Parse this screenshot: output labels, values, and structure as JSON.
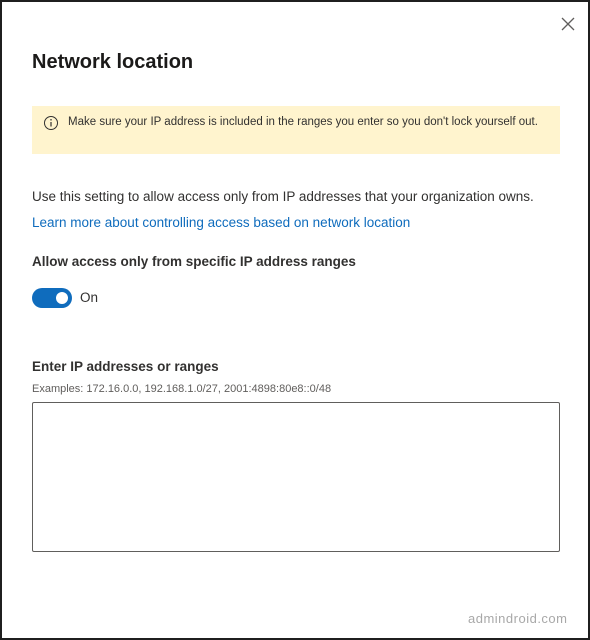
{
  "panel": {
    "title": "Network location",
    "close_icon": "close-icon"
  },
  "warning": {
    "icon": "info-icon",
    "text": "Make sure your IP address is included in the ranges you enter so you don't lock yourself out."
  },
  "description": "Use this setting to allow access only from IP addresses that your organization owns.",
  "learn_more_link": "Learn more about controlling access based on network location",
  "allow_access": {
    "label": "Allow access only from specific IP address ranges",
    "toggle_state": "On",
    "toggle_on": true,
    "accent_color": "#0f6cbd"
  },
  "ip_ranges": {
    "label": "Enter IP addresses or ranges",
    "examples": "Examples: 172.16.0.0, 192.168.1.0/27, 2001:4898:80e8::0/48",
    "value": ""
  },
  "watermark": "admindroid.com"
}
